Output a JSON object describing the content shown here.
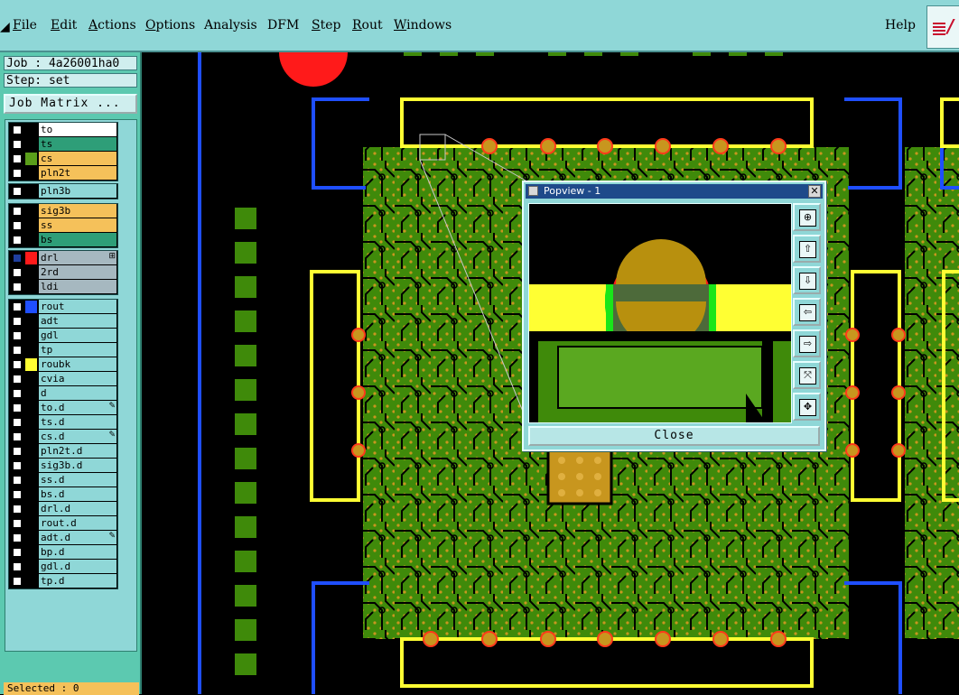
{
  "menubar": {
    "items": [
      {
        "label": "File",
        "u": "F"
      },
      {
        "label": "Edit",
        "u": "E"
      },
      {
        "label": "Actions",
        "u": "A"
      },
      {
        "label": "Options",
        "u": "O"
      },
      {
        "label": "Analysis",
        "u": ""
      },
      {
        "label": "DFM",
        "u": ""
      },
      {
        "label": "Step",
        "u": "S"
      },
      {
        "label": "Rout",
        "u": "R"
      },
      {
        "label": "Windows",
        "u": "W"
      }
    ],
    "help_label": "Help"
  },
  "left_panel": {
    "job_label": "Job : 4a26001ha0",
    "step_label": "Step: set",
    "job_matrix_button": "Job Matrix ...",
    "selected_label": "Selected : 0",
    "layer_groups": [
      [
        {
          "name": "to",
          "color": "#ffffff"
        },
        {
          "name": "ts",
          "color": "#2e9e78"
        },
        {
          "name": "cs",
          "color": "#f5c15a",
          "swatch": "#5a9e1a"
        },
        {
          "name": "pln2t",
          "color": "#f5c15a"
        }
      ],
      [
        {
          "name": "pln3b",
          "color": "#8fd7d7"
        }
      ],
      [
        {
          "name": "sig3b",
          "color": "#f5c15a"
        },
        {
          "name": "ss",
          "color": "#f5c15a"
        },
        {
          "name": "bs",
          "color": "#2e9e78"
        }
      ],
      [
        {
          "name": "drl",
          "color": "#a6b8c0",
          "swatch": "#ff1a1a",
          "mark": "⊞",
          "active": true
        },
        {
          "name": "2rd",
          "color": "#a6b8c0"
        },
        {
          "name": "ldi",
          "color": "#a6b8c0"
        }
      ],
      [
        {
          "name": "rout",
          "color": "#8fd7d7",
          "swatch": "#1f4fff"
        },
        {
          "name": "adt",
          "color": "#8fd7d7"
        },
        {
          "name": "gdl",
          "color": "#8fd7d7"
        },
        {
          "name": "tp",
          "color": "#8fd7d7"
        },
        {
          "name": "roubk",
          "color": "#8fd7d7",
          "swatch": "#ffff33"
        },
        {
          "name": "cvia",
          "color": "#8fd7d7"
        },
        {
          "name": "d",
          "color": "#8fd7d7"
        },
        {
          "name": "to.d",
          "color": "#8fd7d7",
          "mark": "✎"
        },
        {
          "name": "ts.d",
          "color": "#8fd7d7"
        },
        {
          "name": "cs.d",
          "color": "#8fd7d7",
          "mark": "✎"
        },
        {
          "name": "pln2t.d",
          "color": "#8fd7d7"
        },
        {
          "name": "sig3b.d",
          "color": "#8fd7d7"
        },
        {
          "name": "ss.d",
          "color": "#8fd7d7"
        },
        {
          "name": "bs.d",
          "color": "#8fd7d7"
        },
        {
          "name": "drl.d",
          "color": "#8fd7d7"
        },
        {
          "name": "rout.d",
          "color": "#8fd7d7"
        },
        {
          "name": "adt.d",
          "color": "#8fd7d7",
          "mark": "✎"
        },
        {
          "name": "bp.d",
          "color": "#8fd7d7"
        },
        {
          "name": "gdl.d",
          "color": "#8fd7d7"
        },
        {
          "name": "tp.d",
          "color": "#8fd7d7"
        }
      ]
    ]
  },
  "popview": {
    "title": "Popview - 1",
    "close_button": "Close",
    "tools": [
      "zoom-in-icon",
      "pan-up-icon",
      "pan-down-icon",
      "pan-left-icon",
      "pan-right-icon",
      "zoom-fit-icon",
      "zoom-out-icon"
    ]
  },
  "colors": {
    "board_green": "#3f8a0a",
    "copper_pad": "#c8961e",
    "outline_yellow": "#ffff33",
    "rout_blue": "#1f4fff",
    "drill_red": "#ff1a1a",
    "panel_cyan": "#8fd7d7"
  }
}
